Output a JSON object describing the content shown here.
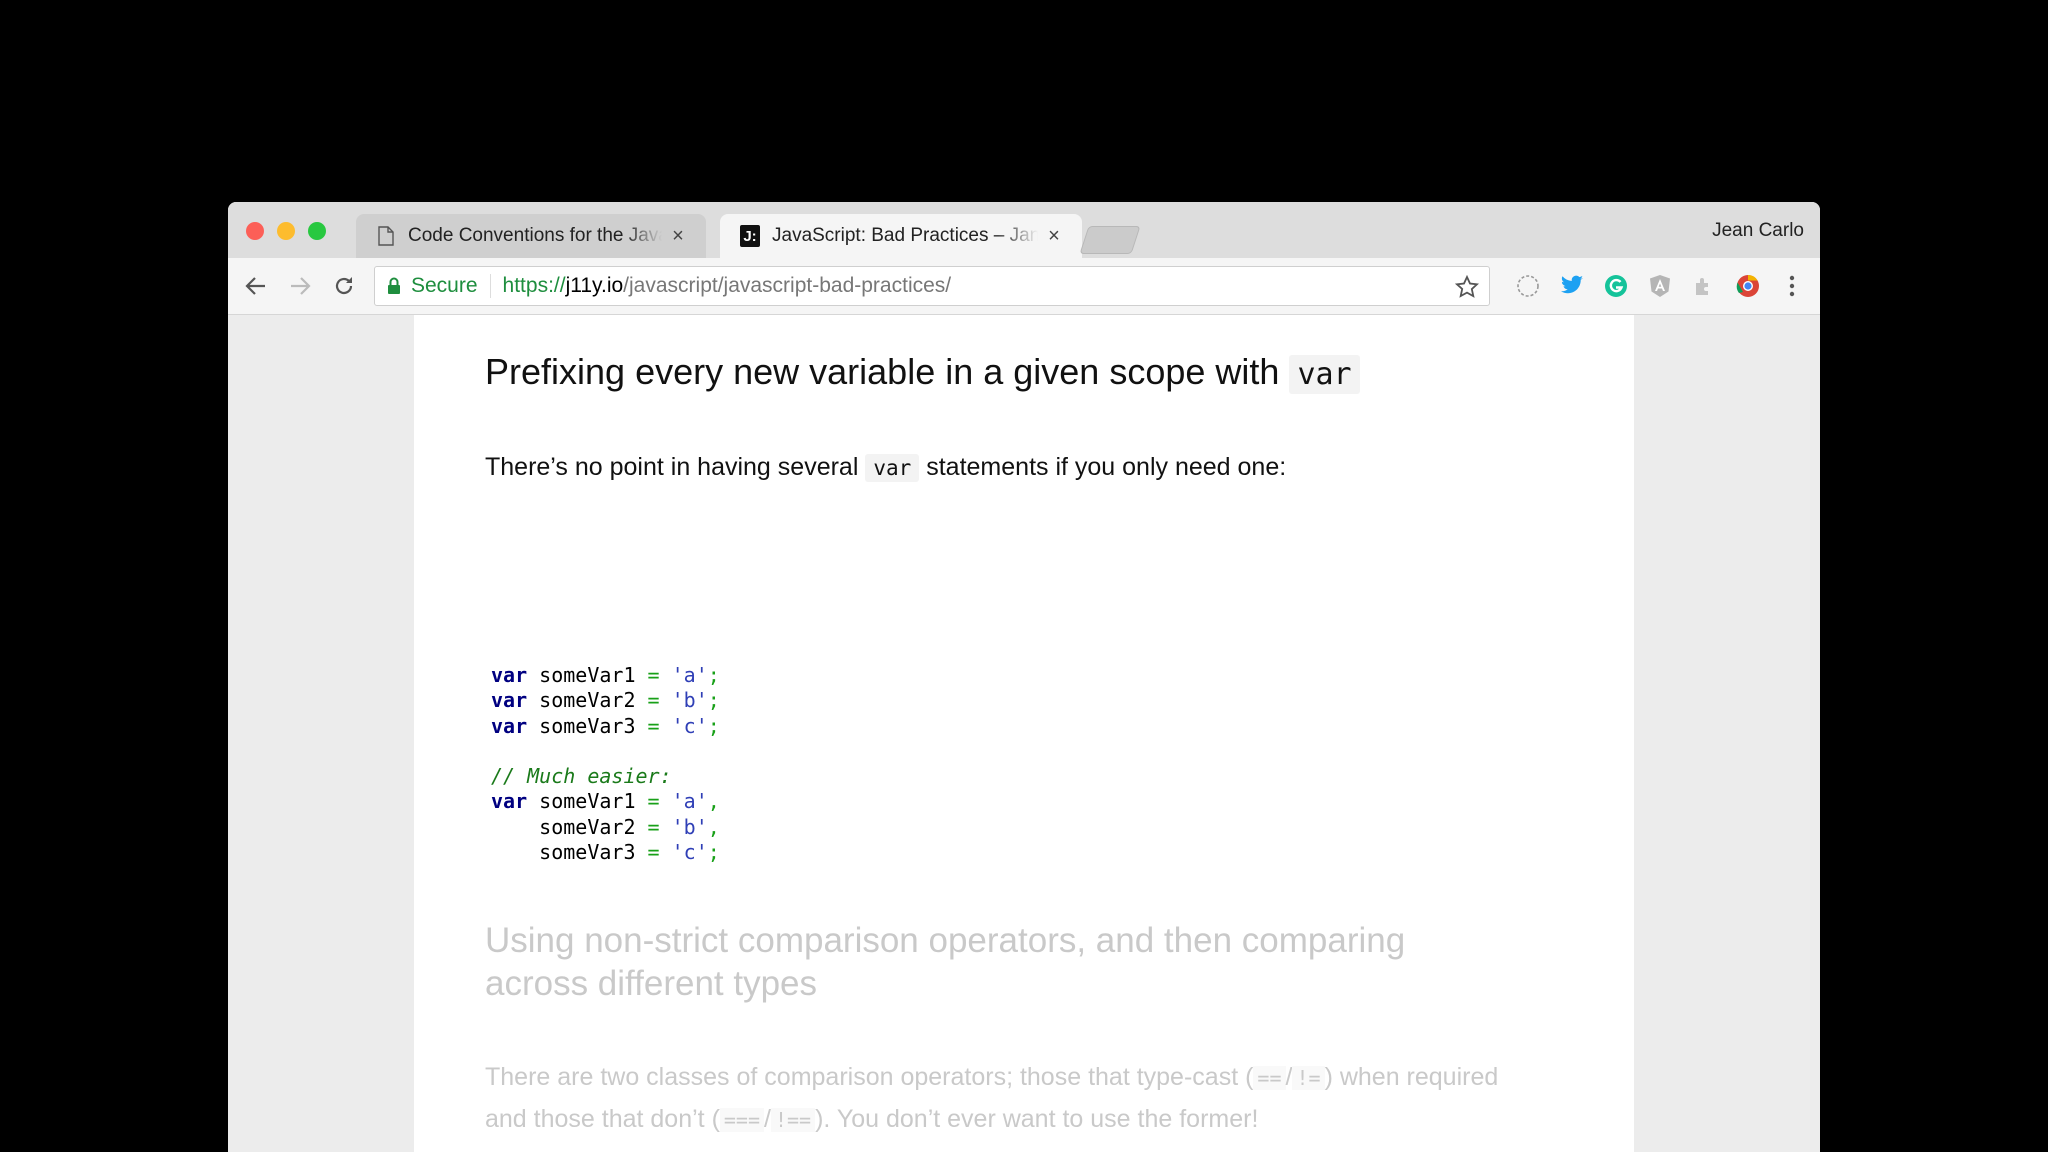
{
  "browser": {
    "profile_name": "Jean Carlo",
    "tabs": [
      {
        "title": "Code Conventions for the JavaScript",
        "active": false,
        "icon": "page-icon"
      },
      {
        "title": "JavaScript: Bad Practices – Jan",
        "active": true,
        "icon": "j-favicon",
        "favicon_text": "J:"
      }
    ],
    "omnibox": {
      "secure_label": "Secure",
      "url_scheme": "https://",
      "url_host": "j11y.io",
      "url_path": "/javascript/javascript-bad-practices/"
    },
    "extensions": [
      "circle-extension-icon",
      "twitter-icon",
      "grammarly-icon",
      "angular-icon",
      "puzzle-extension-icon",
      "chrome-profile-icon",
      "more-menu-icon"
    ],
    "colors": {
      "secure": "#1e8e3e",
      "twitter": "#1da1f2",
      "grammarly": "#15c39a"
    }
  },
  "article": {
    "heading_text": "Prefixing every new variable in a given scope with",
    "heading_code": "var",
    "para_before": "There’s no point in having several",
    "para_code": "var",
    "para_after": "statements if you only need one:",
    "code": {
      "kw": "var",
      "eq": "=",
      "semi": ";",
      "comma": ",",
      "comment": "// Much easier:",
      "names": [
        "someVar1",
        "someVar2",
        "someVar3"
      ],
      "values": [
        "'a'",
        "'b'",
        "'c'"
      ]
    },
    "next_heading": "Using non-strict comparison operators, and then comparing across different types",
    "next_para_1": "There are two classes of comparison operators; those that type-cast (",
    "next_op_1": "==",
    "next_op_sep": "/",
    "next_op_2": "!=",
    "next_para_2": ") when required and those that don’t (",
    "next_op_3": "===",
    "next_op_4": "!==",
    "next_para_3": "). You don’t ever want to use the former!"
  }
}
